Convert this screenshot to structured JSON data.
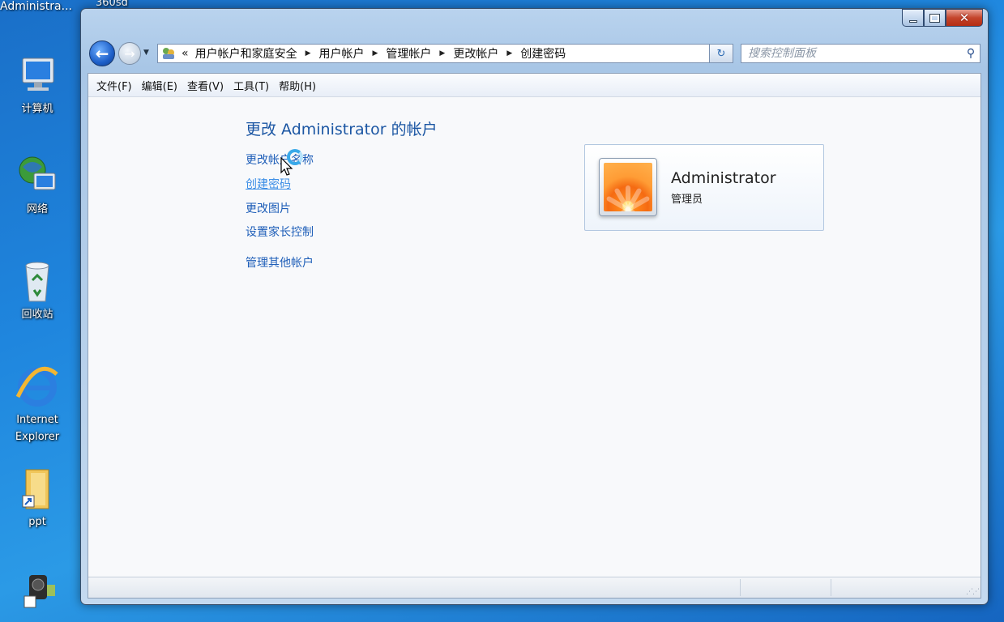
{
  "desktop": {
    "top_label": "Administra...",
    "top_label2": "360sd",
    "icons": [
      {
        "label": "计算机"
      },
      {
        "label": "网络"
      },
      {
        "label": "回收站"
      },
      {
        "label": "Internet Explorer"
      },
      {
        "label": "ppt"
      }
    ]
  },
  "address_bar": {
    "overflow": "«",
    "crumbs": [
      "用户帐户和家庭安全",
      "用户帐户",
      "管理帐户",
      "更改帐户",
      "创建密码"
    ]
  },
  "search": {
    "placeholder": "搜索控制面板"
  },
  "menu": [
    "文件(F)",
    "编辑(E)",
    "查看(V)",
    "工具(T)",
    "帮助(H)"
  ],
  "content": {
    "title": "更改 Administrator 的帐户",
    "links": [
      "更改帐户名称",
      "创建密码",
      "更改图片",
      "设置家长控制",
      "管理其他帐户"
    ]
  },
  "account": {
    "name": "Administrator",
    "role": "管理员"
  }
}
